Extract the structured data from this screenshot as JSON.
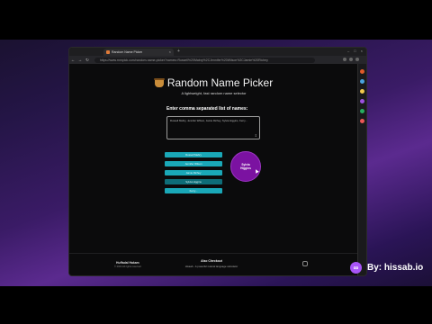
{
  "browser": {
    "tab_title": "Random Name Picker",
    "url": "https://www.rnmpick.com/random-name-picker?names=Russell%20Mabry%2CJennifer%20Wilson%2CJamie%20Richey",
    "sidebar_colors": [
      "#e05a2a",
      "#4aa3df",
      "#f2c94c",
      "#9b51e0",
      "#27ae60",
      "#eb5757"
    ]
  },
  "app": {
    "title": "Random Name Picker",
    "subtitle": "A lightweight, fast random name selector",
    "input_label": "Enter comma separated list of names:",
    "textarea_value": "Russell Mabry, Jennifer Wilson, Jamie Richey, Sylvia Higgins, Kerry...",
    "names": [
      "Russell Mabry",
      "Jennifer Wilson",
      "Jamie Richey",
      "Sylvia Higgins",
      "Kerry..."
    ],
    "picked_line1": "Sylvia",
    "picked_line2": "Higgins"
  },
  "footer": {
    "author": "Huffadal Hakam",
    "copyright": "© 2024 All rights reserved",
    "mid_title": "Also Checkout",
    "mid_text": "Hisaab - A powerful natural language calculator"
  },
  "brand": {
    "text": "By: hissab.io"
  }
}
